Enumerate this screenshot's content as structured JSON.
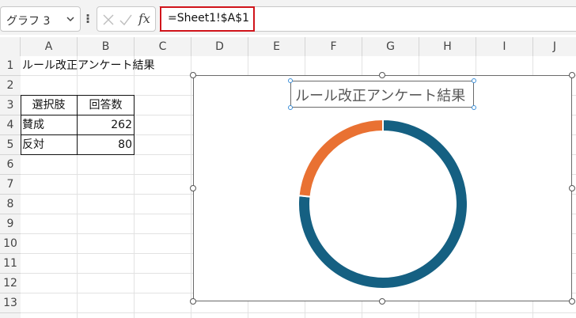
{
  "name_box": {
    "value": "グラフ 3"
  },
  "formula_bar": {
    "formula": "=Sheet1!$A$1",
    "fx_label": "fx"
  },
  "columns": [
    "A",
    "B",
    "C",
    "D",
    "E",
    "F",
    "G",
    "H",
    "I",
    "J"
  ],
  "rows": [
    "1",
    "2",
    "3",
    "4",
    "5",
    "6",
    "7",
    "8",
    "9",
    "10",
    "11",
    "12",
    "13"
  ],
  "cells": {
    "a1": "ルール改正アンケート結果",
    "a3": "選択肢",
    "b3": "回答数",
    "a4": "賛成",
    "b4": "262",
    "a5": "反対",
    "b5": "80"
  },
  "chart": {
    "title": "ルール改正アンケート結果",
    "colors": {
      "series_1": "#156082",
      "series_2": "#e97132"
    }
  },
  "chart_data": {
    "type": "pie",
    "subtype": "doughnut",
    "title": "ルール改正アンケート結果",
    "categories": [
      "賛成",
      "反対"
    ],
    "values": [
      262,
      80
    ],
    "colors": [
      "#156082",
      "#e97132"
    ],
    "legend": "none"
  }
}
